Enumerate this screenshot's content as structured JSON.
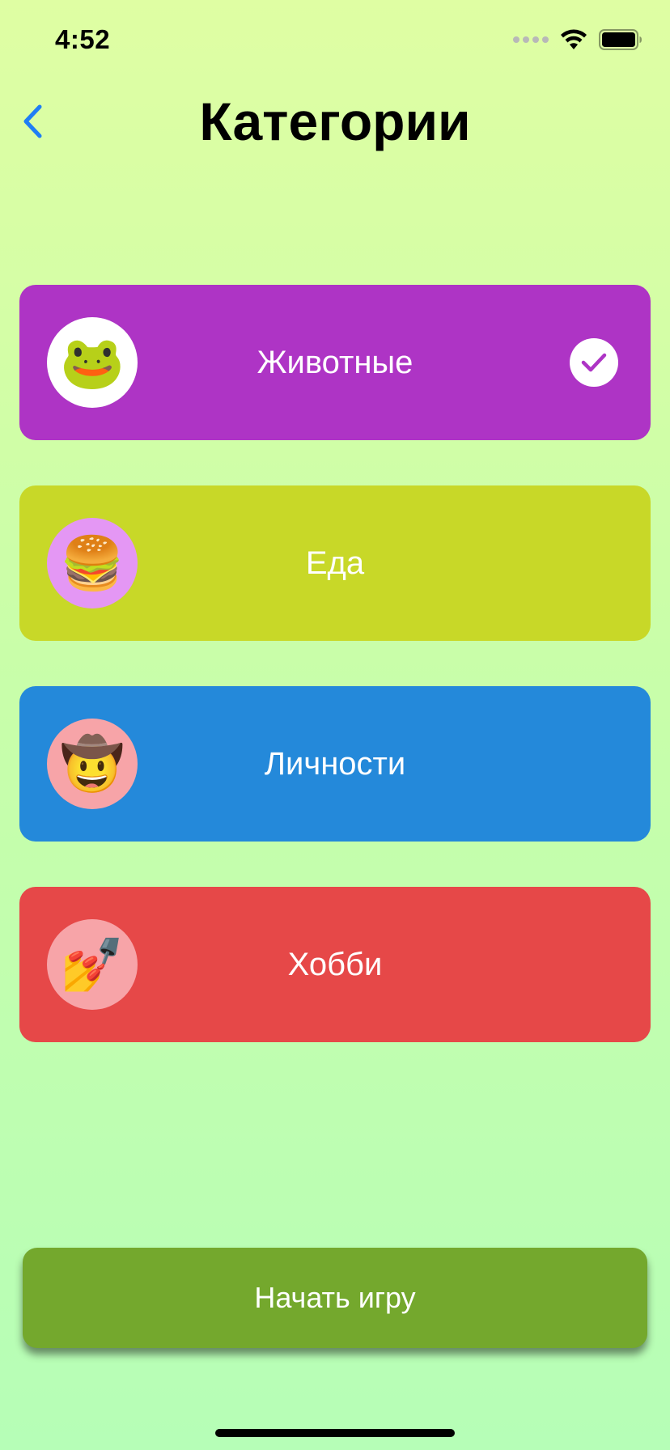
{
  "status_bar": {
    "time": "4:52",
    "icons": [
      "signal-icon",
      "wifi-icon",
      "battery-icon"
    ]
  },
  "nav": {
    "back_icon": "chevron-left-icon",
    "title": "Категории"
  },
  "categories": [
    {
      "label": "Животные",
      "emoji": "🐸",
      "color": "#ae34c5",
      "icon_bg": "#ffffff",
      "selected": true
    },
    {
      "label": "Еда",
      "emoji": "🍔",
      "color": "#c8d828",
      "icon_bg": "#e497f4",
      "selected": false
    },
    {
      "label": "Личности",
      "emoji": "🤠",
      "color": "#2489da",
      "icon_bg": "#f7a4a8",
      "selected": false
    },
    {
      "label": "Хобби",
      "emoji": "💅",
      "color": "#e64848",
      "icon_bg": "#f7a4a8",
      "selected": false
    }
  ],
  "start_button": {
    "label": "Начать игру",
    "color": "#74a82d"
  },
  "colors": {
    "accent": "#1f7ef5",
    "background_top": "#dffea3",
    "background_bottom": "#b6feb7"
  }
}
